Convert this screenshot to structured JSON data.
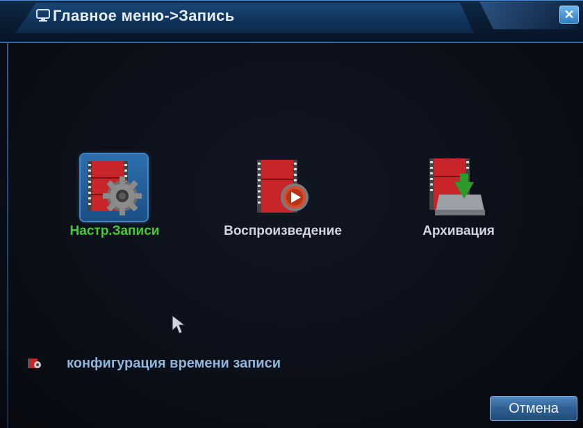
{
  "window": {
    "title": "Главное меню->Запись",
    "title_icon": "monitor-icon",
    "close_label": "✕"
  },
  "menu": {
    "items": [
      {
        "label": "Настр.Записи",
        "icon": "record-settings-icon",
        "selected": true
      },
      {
        "label": "Воспроизведение",
        "icon": "playback-icon",
        "selected": false
      },
      {
        "label": "Архивация",
        "icon": "backup-icon",
        "selected": false
      }
    ]
  },
  "config": {
    "label": "конфигурация времени записи",
    "icon": "record-schedule-icon"
  },
  "footer": {
    "cancel_label": "Отмена"
  },
  "colors": {
    "active_label": "#49c83a",
    "normal_label": "#cfd6e0",
    "accent": "#2c6fb0"
  }
}
